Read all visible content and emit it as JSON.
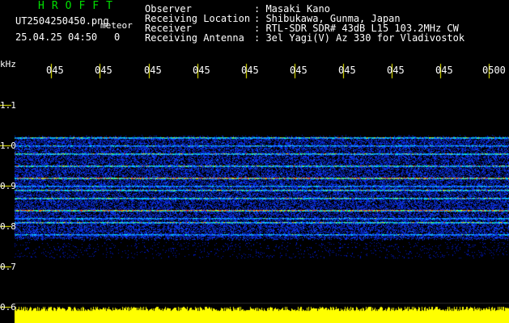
{
  "window_title": "HROFFT",
  "file": {
    "name": "UT2504250450.png",
    "type_label": "meteor",
    "datetime": "25.04.25 04:50",
    "count": "0"
  },
  "info": {
    "labels": [
      "Observer",
      "Receiving Location",
      "Receiver",
      "Receiving Antenna"
    ],
    "values": [
      ": Masaki Kano",
      ": Shibukawa, Gunma, Japan",
      ": RTL-SDR SDR# 43dB L15 103.2MHz CW",
      ": 3el Yagi(V) Az 330 for Vladivostok"
    ]
  },
  "y_unit": "kHz",
  "time_labels": [
    "045",
    "045",
    "045",
    "045",
    "045",
    "045",
    "045",
    "045",
    "045",
    "0500"
  ],
  "freq_labels": [
    "1.1",
    "1.0",
    "0.9",
    "0.8",
    "0.7",
    "0.6"
  ],
  "colors": {
    "title": "#00e000",
    "tick": "#ffff00",
    "background_noise": "#0018c8",
    "signal_level": "#ffff00"
  },
  "spectrogram": {
    "band_khz": [
      0.76,
      1.03
    ],
    "strong_lines_khz": [
      0.92,
      0.84
    ],
    "medium_lines_khz": [
      1.02,
      0.98,
      0.95,
      0.89,
      0.87,
      0.81
    ],
    "weak_lines_khz": [
      1.0,
      0.9,
      0.82,
      0.78
    ]
  }
}
